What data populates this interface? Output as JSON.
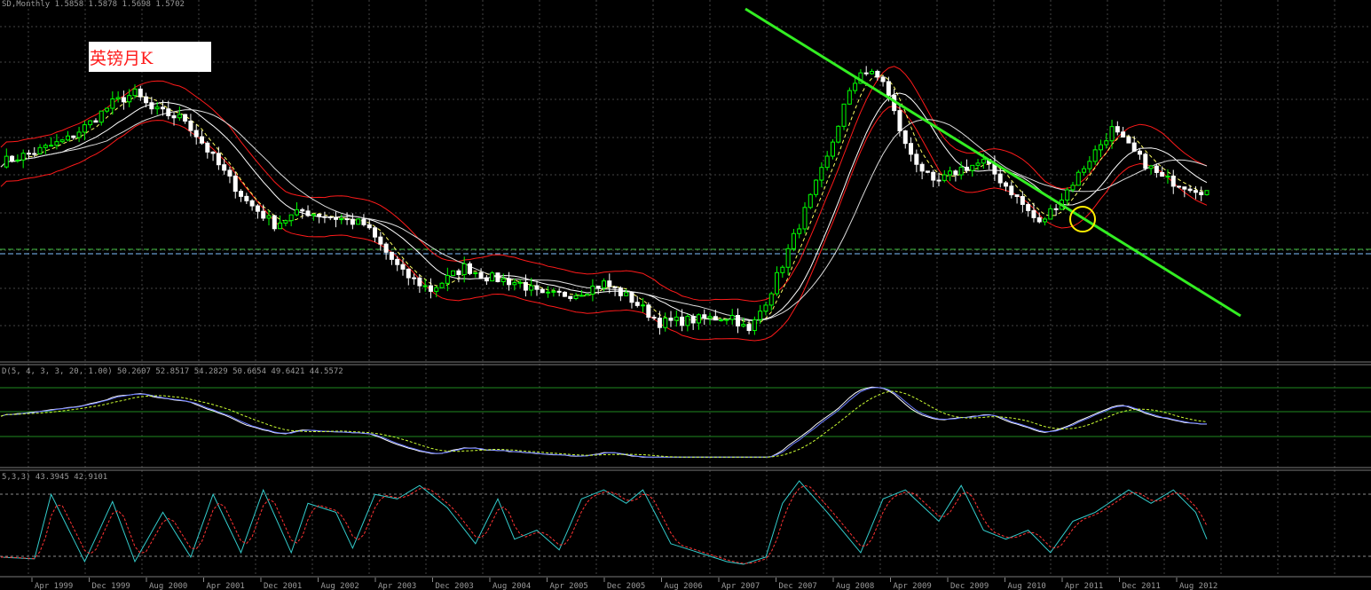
{
  "header": {
    "main": "SD,Monthly  1.5858 1.5878 1.5698 1.5702",
    "osc1": "D(5, 4, 3, 3, 20, 1.00) 50.2607 52.8517 54.2829 50.6654 49.6421 44.5572",
    "osc2": "5,3,3) 43.3945 42.9101"
  },
  "annotation": {
    "title": "英镑月K"
  },
  "colors": {
    "bull": "#00ff00",
    "bear": "#ffffff",
    "band": "#ff1a1a",
    "ma": "#ffffff",
    "trendline": "#33ee22",
    "circle": "#ffee00",
    "grid": "#444444"
  },
  "chart_data": {
    "type": "candlestick",
    "panes": [
      "price",
      "oscillator",
      "stochastic"
    ],
    "x_ticks": [
      "Apr 1999",
      "Dec 1999",
      "Aug 2000",
      "Apr 2001",
      "Dec 2001",
      "Aug 2002",
      "Apr 2003",
      "Dec 2003",
      "Aug 2004",
      "Apr 2005",
      "Dec 2005",
      "Aug 2006",
      "Apr 2007",
      "Dec 2007",
      "Aug 2008",
      "Apr 2009",
      "Dec 2009",
      "Aug 2010",
      "Apr 2011",
      "Dec 2011",
      "Aug 2012"
    ],
    "price_shape": [
      [
        0,
        0.57
      ],
      [
        6,
        0.6
      ],
      [
        12,
        0.64
      ],
      [
        16,
        0.69
      ],
      [
        20,
        0.75
      ],
      [
        24,
        0.78
      ],
      [
        27,
        0.73
      ],
      [
        33,
        0.7
      ],
      [
        39,
        0.56
      ],
      [
        44,
        0.45
      ],
      [
        49,
        0.38
      ],
      [
        54,
        0.42
      ],
      [
        60,
        0.4
      ],
      [
        65,
        0.38
      ],
      [
        72,
        0.23
      ],
      [
        77,
        0.18
      ],
      [
        83,
        0.25
      ],
      [
        87,
        0.22
      ],
      [
        93,
        0.2
      ],
      [
        97,
        0.16
      ],
      [
        103,
        0.17
      ],
      [
        108,
        0.2
      ],
      [
        113,
        0.15
      ],
      [
        118,
        0.08
      ],
      [
        125,
        0.09
      ],
      [
        131,
        0.1
      ],
      [
        134,
        0.05
      ],
      [
        138,
        0.18
      ],
      [
        144,
        0.42
      ],
      [
        148,
        0.58
      ],
      [
        151,
        0.74
      ],
      [
        154,
        0.85
      ],
      [
        158,
        0.82
      ],
      [
        162,
        0.62
      ],
      [
        167,
        0.5
      ],
      [
        172,
        0.55
      ],
      [
        176,
        0.57
      ],
      [
        181,
        0.48
      ],
      [
        186,
        0.38
      ],
      [
        190,
        0.46
      ],
      [
        195,
        0.58
      ],
      [
        199,
        0.67
      ],
      [
        204,
        0.58
      ],
      [
        208,
        0.52
      ],
      [
        212,
        0.5
      ],
      [
        216,
        0.48
      ]
    ],
    "stoch_shape": [
      [
        0,
        0.1
      ],
      [
        6,
        0.08
      ],
      [
        9,
        0.8
      ],
      [
        15,
        0.05
      ],
      [
        20,
        0.72
      ],
      [
        24,
        0.05
      ],
      [
        29,
        0.6
      ],
      [
        34,
        0.1
      ],
      [
        38,
        0.8
      ],
      [
        43,
        0.15
      ],
      [
        47,
        0.85
      ],
      [
        52,
        0.15
      ],
      [
        55,
        0.7
      ],
      [
        60,
        0.6
      ],
      [
        63,
        0.2
      ],
      [
        67,
        0.8
      ],
      [
        71,
        0.75
      ],
      [
        75,
        0.9
      ],
      [
        80,
        0.65
      ],
      [
        85,
        0.25
      ],
      [
        89,
        0.75
      ],
      [
        92,
        0.3
      ],
      [
        96,
        0.4
      ],
      [
        100,
        0.18
      ],
      [
        104,
        0.75
      ],
      [
        108,
        0.85
      ],
      [
        112,
        0.7
      ],
      [
        115,
        0.85
      ],
      [
        120,
        0.25
      ],
      [
        125,
        0.15
      ],
      [
        130,
        0.05
      ],
      [
        133,
        0.02
      ],
      [
        137,
        0.1
      ],
      [
        140,
        0.7
      ],
      [
        143,
        0.95
      ],
      [
        148,
        0.6
      ],
      [
        154,
        0.15
      ],
      [
        158,
        0.75
      ],
      [
        162,
        0.85
      ],
      [
        168,
        0.5
      ],
      [
        172,
        0.9
      ],
      [
        176,
        0.4
      ],
      [
        180,
        0.3
      ],
      [
        184,
        0.4
      ],
      [
        188,
        0.15
      ],
      [
        192,
        0.5
      ],
      [
        196,
        0.6
      ],
      [
        202,
        0.85
      ],
      [
        206,
        0.7
      ],
      [
        210,
        0.85
      ],
      [
        214,
        0.6
      ],
      [
        216,
        0.3
      ]
    ]
  }
}
